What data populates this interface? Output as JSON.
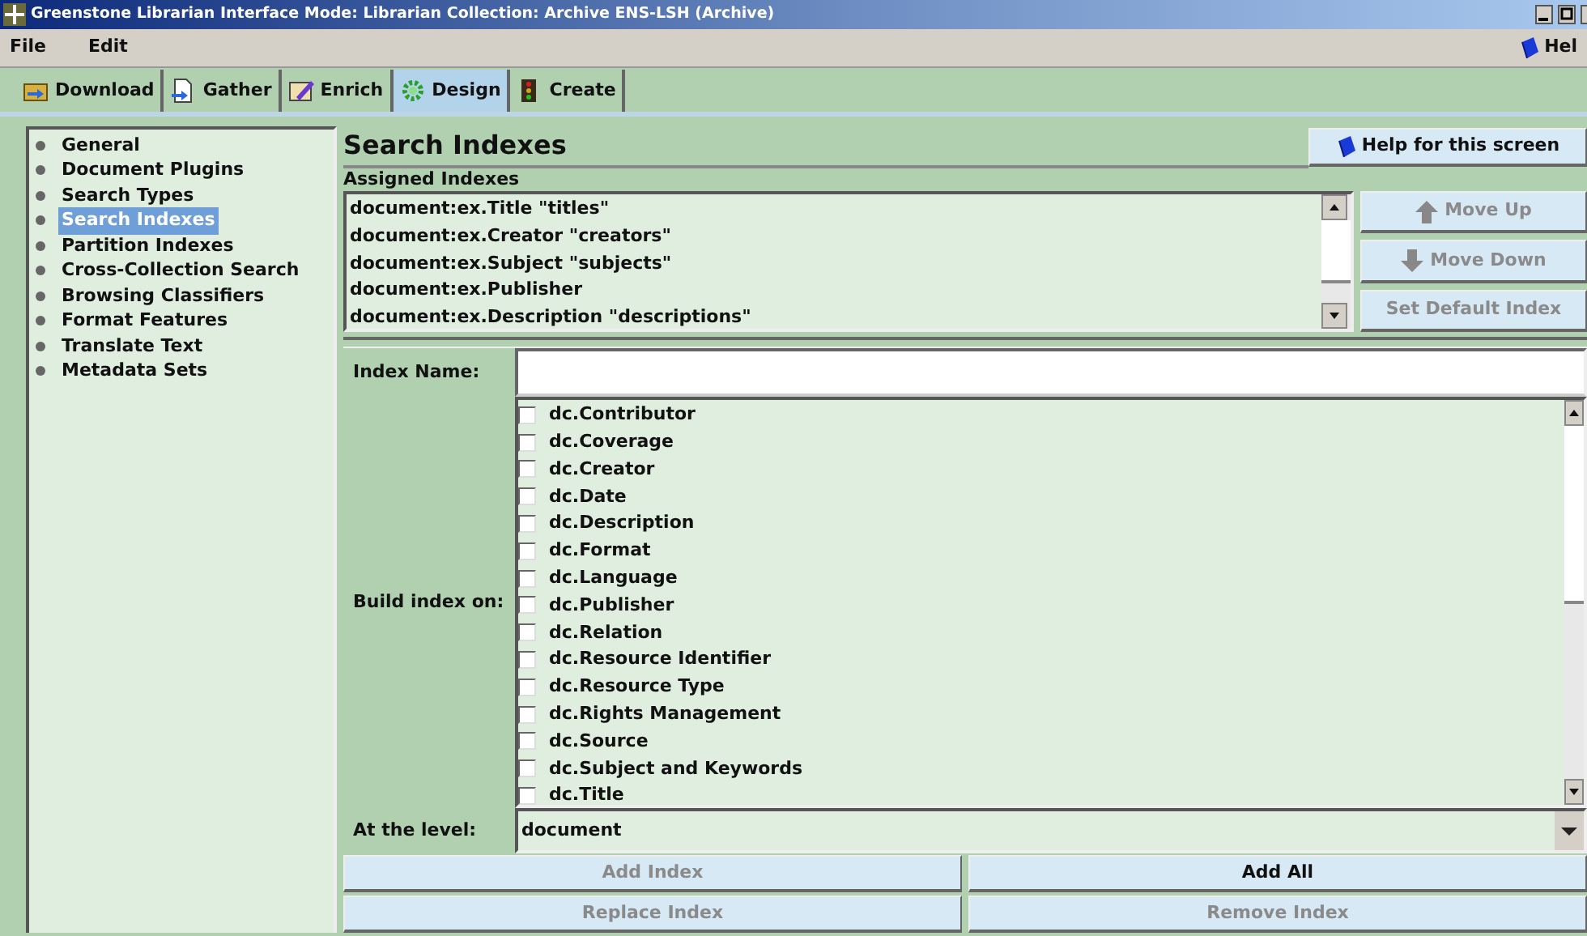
{
  "window": {
    "title": "Greenstone Librarian Interface  Mode: Librarian  Collection: Archive ENS-LSH (Archive)"
  },
  "menu": [
    {
      "label": "File"
    },
    {
      "label": "Edit"
    }
  ],
  "help_menu": {
    "label": "Hel"
  },
  "tabs": [
    {
      "label": "Download",
      "kind": "download",
      "selected": false
    },
    {
      "label": "Gather",
      "kind": "gather",
      "selected": false
    },
    {
      "label": "Enrich",
      "kind": "enrich",
      "selected": false
    },
    {
      "label": "Design",
      "kind": "design",
      "selected": true
    },
    {
      "label": "Create",
      "kind": "create",
      "selected": false
    }
  ],
  "sidebar": {
    "items": [
      {
        "label": "General",
        "selected": false
      },
      {
        "label": "Document Plugins",
        "selected": false
      },
      {
        "label": "Search Types",
        "selected": false
      },
      {
        "label": "Search Indexes",
        "selected": true
      },
      {
        "label": "Partition Indexes",
        "selected": false
      },
      {
        "label": "Cross-Collection Search",
        "selected": false
      },
      {
        "label": "Browsing Classifiers",
        "selected": false
      },
      {
        "label": "Format Features",
        "selected": false
      },
      {
        "label": "Translate Text",
        "selected": false
      },
      {
        "label": "Metadata Sets",
        "selected": false
      }
    ]
  },
  "panel": {
    "title": "Search Indexes",
    "help_button": "Help for this screen",
    "assigned_label": "Assigned Indexes",
    "assigned_indexes": [
      "document:ex.Title \"titles\"",
      "document:ex.Creator \"creators\"",
      "document:ex.Subject \"subjects\"",
      "document:ex.Publisher",
      "document:ex.Description \"descriptions\""
    ],
    "side_buttons": [
      {
        "label": "Move Up",
        "kind": "up",
        "disabled": true
      },
      {
        "label": "Move Down",
        "kind": "down",
        "disabled": true
      },
      {
        "label": "Set Default Index",
        "kind": "plain",
        "disabled": true
      }
    ],
    "index_name_label": "Index Name:",
    "build_label": "Build index on:",
    "metadata": [
      {
        "label": "dc.Contributor",
        "checked": false
      },
      {
        "label": "dc.Coverage",
        "checked": false
      },
      {
        "label": "dc.Creator",
        "checked": false
      },
      {
        "label": "dc.Date",
        "checked": false
      },
      {
        "label": "dc.Description",
        "checked": false
      },
      {
        "label": "dc.Format",
        "checked": false
      },
      {
        "label": "dc.Language",
        "checked": false
      },
      {
        "label": "dc.Publisher",
        "checked": false
      },
      {
        "label": "dc.Relation",
        "checked": false
      },
      {
        "label": "dc.Resource Identifier",
        "checked": false
      },
      {
        "label": "dc.Resource Type",
        "checked": false
      },
      {
        "label": "dc.Rights Management",
        "checked": false
      },
      {
        "label": "dc.Source",
        "checked": false
      },
      {
        "label": "dc.Subject and Keywords",
        "checked": false
      },
      {
        "label": "dc.Title",
        "checked": false
      }
    ],
    "level_label": "At the level:",
    "level_value": "document",
    "bottom_buttons": [
      {
        "label": "Add Index",
        "disabled": true
      },
      {
        "label": "Add All",
        "disabled": false
      },
      {
        "label": "Replace Index",
        "disabled": true
      },
      {
        "label": "Remove Index",
        "disabled": true
      }
    ]
  }
}
